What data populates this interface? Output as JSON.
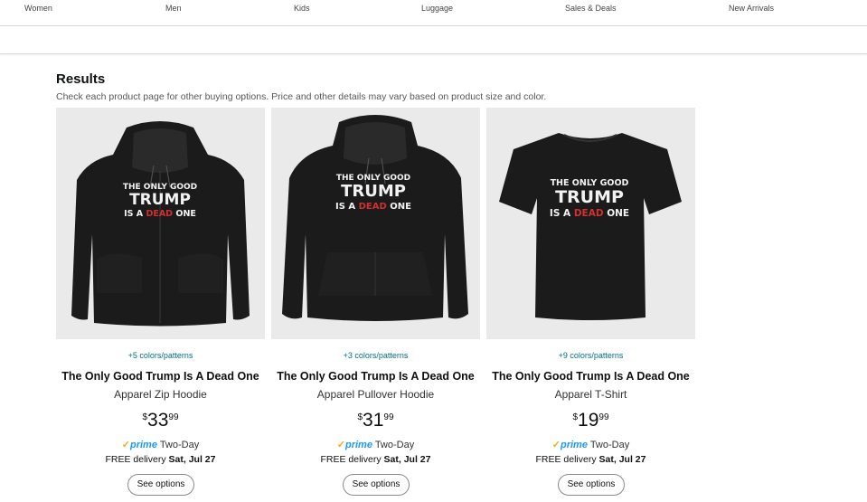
{
  "nav": {
    "items": [
      "Women",
      "Men",
      "Kids",
      "Luggage",
      "Sales & Deals",
      "New Arrivals"
    ]
  },
  "results": {
    "title": "Results",
    "subtitle": "Check each product page for other buying options. Price and other details may vary based on product size and color."
  },
  "products": [
    {
      "colors": "+5 colors/patterns",
      "title": "The Only Good Trump Is A Dead One",
      "subtitle": "Apparel Zip Hoodie",
      "price_symbol": "$",
      "price_whole": "33",
      "price_fraction": "99",
      "prime_check": "✓",
      "prime_label": "prime",
      "prime_speed": "Two-Day",
      "delivery_prefix": "FREE delivery ",
      "delivery_date": "Sat, Jul 27",
      "button": "See options",
      "print": {
        "line1": "THE ONLY GOOD",
        "line2": "TRUMP",
        "line3a": "IS A ",
        "line3b": "DEAD",
        "line3c": " ONE"
      }
    },
    {
      "colors": "+3 colors/patterns",
      "title": "The Only Good Trump Is A Dead One",
      "subtitle": "Apparel Pullover Hoodie",
      "price_symbol": "$",
      "price_whole": "31",
      "price_fraction": "99",
      "prime_check": "✓",
      "prime_label": "prime",
      "prime_speed": "Two-Day",
      "delivery_prefix": "FREE delivery ",
      "delivery_date": "Sat, Jul 27",
      "button": "See options",
      "print": {
        "line1": "THE ONLY GOOD",
        "line2": "TRUMP",
        "line3a": "IS A ",
        "line3b": "DEAD",
        "line3c": " ONE"
      }
    },
    {
      "colors": "+9 colors/patterns",
      "title": "The Only Good Trump Is A Dead One",
      "subtitle": "Apparel T-Shirt",
      "price_symbol": "$",
      "price_whole": "19",
      "price_fraction": "99",
      "prime_check": "✓",
      "prime_label": "prime",
      "prime_speed": "Two-Day",
      "delivery_prefix": "FREE delivery ",
      "delivery_date": "Sat, Jul 27",
      "button": "See options",
      "print": {
        "line1": "THE ONLY GOOD",
        "line2": "TRUMP",
        "line3a": "IS A ",
        "line3b": "DEAD",
        "line3c": " ONE"
      }
    }
  ],
  "colors": {
    "link": "#007185",
    "prime_check": "#f7a81b",
    "prime_blue": "#1a98ff",
    "garment": "#1b1b1b",
    "print_white": "#f2f2f2",
    "print_red": "#d0302f",
    "image_bg": "#eaeaea"
  }
}
